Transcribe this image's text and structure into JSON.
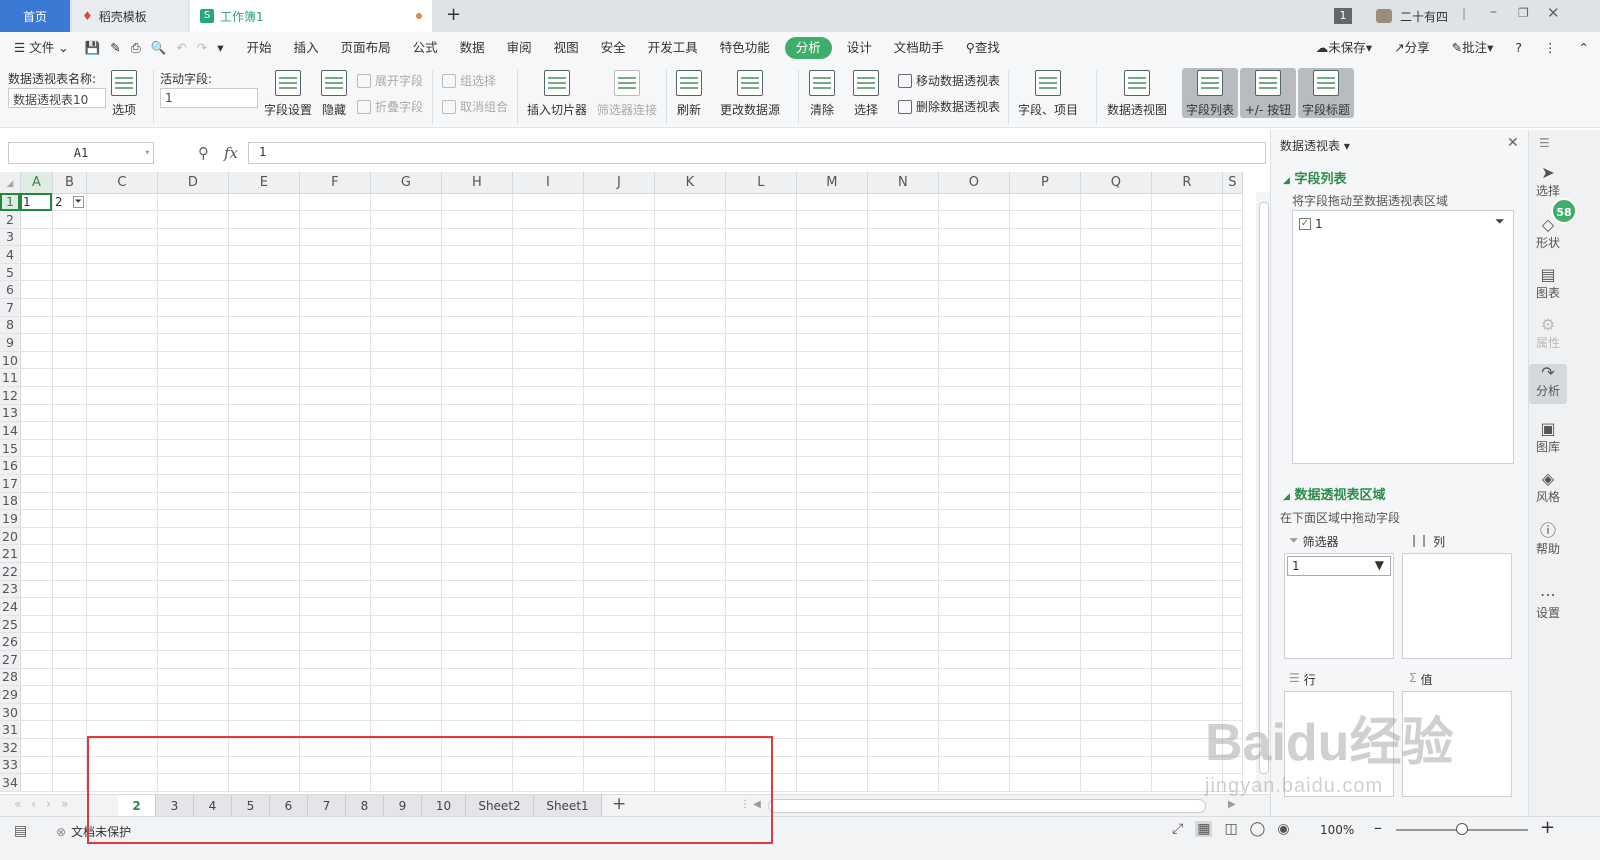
{
  "tabs": {
    "home": "首页",
    "docer": "稻壳模板",
    "workbook": "工作簿1"
  },
  "titlebar": {
    "badge": "1",
    "user": "二十有四"
  },
  "menu": {
    "file": "文件",
    "items": [
      "开始",
      "插入",
      "页面布局",
      "公式",
      "数据",
      "审阅",
      "视图",
      "安全",
      "开发工具",
      "特色功能",
      "分析",
      "设计",
      "文档助手"
    ],
    "active": "分析",
    "search": "查找",
    "unsaved": "未保存",
    "share": "分享",
    "comment": "批注"
  },
  "ribbon": {
    "pivot_name_label": "数据透视表名称:",
    "pivot_name_value": "数据透视表10",
    "options": "选项",
    "active_field_label": "活动字段:",
    "active_field_value": "1",
    "field_settings": "字段设置",
    "hide": "隐藏",
    "expand_field": "展开字段",
    "collapse_field": "折叠字段",
    "group_selection": "组选择",
    "ungroup": "取消组合",
    "insert_slicer": "插入切片器",
    "filter_connection": "筛选器连接",
    "refresh": "刷新",
    "change_source": "更改数据源",
    "clear": "清除",
    "select": "选择",
    "move_pivot": "移动数据透视表",
    "delete_pivot": "删除数据透视表",
    "fields_items": "字段、项目",
    "pivot_chart": "数据透视图",
    "field_list": "字段列表",
    "buttons": "+/- 按钮",
    "field_headers": "字段标题"
  },
  "formula": {
    "cell_ref": "A1",
    "fx": "fx",
    "value": "1"
  },
  "grid": {
    "columns": [
      "A",
      "B",
      "C",
      "D",
      "E",
      "F",
      "G",
      "H",
      "I",
      "J",
      "K",
      "L",
      "M",
      "N",
      "O",
      "P",
      "Q",
      "R",
      "S"
    ],
    "row_count": 34,
    "a1": "1",
    "b1": "2"
  },
  "sheets": {
    "names": [
      "2",
      "3",
      "4",
      "5",
      "6",
      "7",
      "8",
      "9",
      "10",
      "Sheet2",
      "Sheet1"
    ],
    "active": "2"
  },
  "status": {
    "protect": "文档未保护",
    "zoom": "100%"
  },
  "panel": {
    "header": "数据透视表",
    "field_list_title": "字段列表",
    "field_list_hint": "将字段拖动至数据透视表区域",
    "field_item": "1",
    "areas_title": "数据透视表区域",
    "areas_hint": "在下面区域中拖动字段",
    "filter": "筛选器",
    "filter_value": "1",
    "columns": "列",
    "rows": "行",
    "values": "值"
  },
  "sidebar": {
    "select": "选择",
    "shape": "形状",
    "chart": "图表",
    "attr": "属性",
    "analyze": "分析",
    "gallery": "图库",
    "style": "风格",
    "help": "帮助",
    "settings": "设置",
    "badge": "58"
  },
  "watermark": {
    "main": "Baidu经验",
    "sub": "jingyan.baidu.com"
  },
  "colors": {
    "accent": "#3fae6a",
    "tab_blue": "#3a7ad5",
    "annotation": "#e03a3a"
  }
}
